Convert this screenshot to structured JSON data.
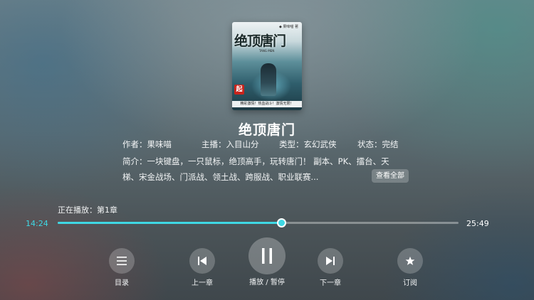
{
  "cover": {
    "title_text": "绝顶唐门",
    "author_text": "果味喵 著",
    "subtitle_text": "TANG MEN",
    "banner_text": "精彩激情！热血战斗！激情无限！",
    "logo_text": "起",
    "icon": "book-cover-image"
  },
  "book": {
    "title": "绝顶唐门",
    "author": "作者：果味喵",
    "narrator": "主播：入目山分",
    "category": "类型：玄幻武侠",
    "status": "状态：完结",
    "description_line1": "简介：一块键盘，一只鼠标，绝顶高手，玩转唐门！ 副本、PK、擂台、天",
    "description_line2": "梯、宋金战场、门派战、领土战、跨服战、职业联赛...",
    "view_all_label": "查看全部"
  },
  "player": {
    "now_playing": "正在播放：第1章",
    "current_time": "14:24",
    "total_time": "25:49",
    "progress_fraction": 0.559
  },
  "controls": [
    {
      "id": "toc",
      "label": "目录",
      "icon": "list-icon"
    },
    {
      "id": "prev",
      "label": "上一章",
      "icon": "skip-previous-icon"
    },
    {
      "id": "play",
      "label": "播放 / 暂停",
      "icon": "pause-icon"
    },
    {
      "id": "next",
      "label": "下一章",
      "icon": "skip-next-icon"
    },
    {
      "id": "subscribe",
      "label": "订阅",
      "icon": "star-icon"
    }
  ],
  "colors": {
    "accent": "#3fd8e4",
    "text": "#ffffff"
  }
}
